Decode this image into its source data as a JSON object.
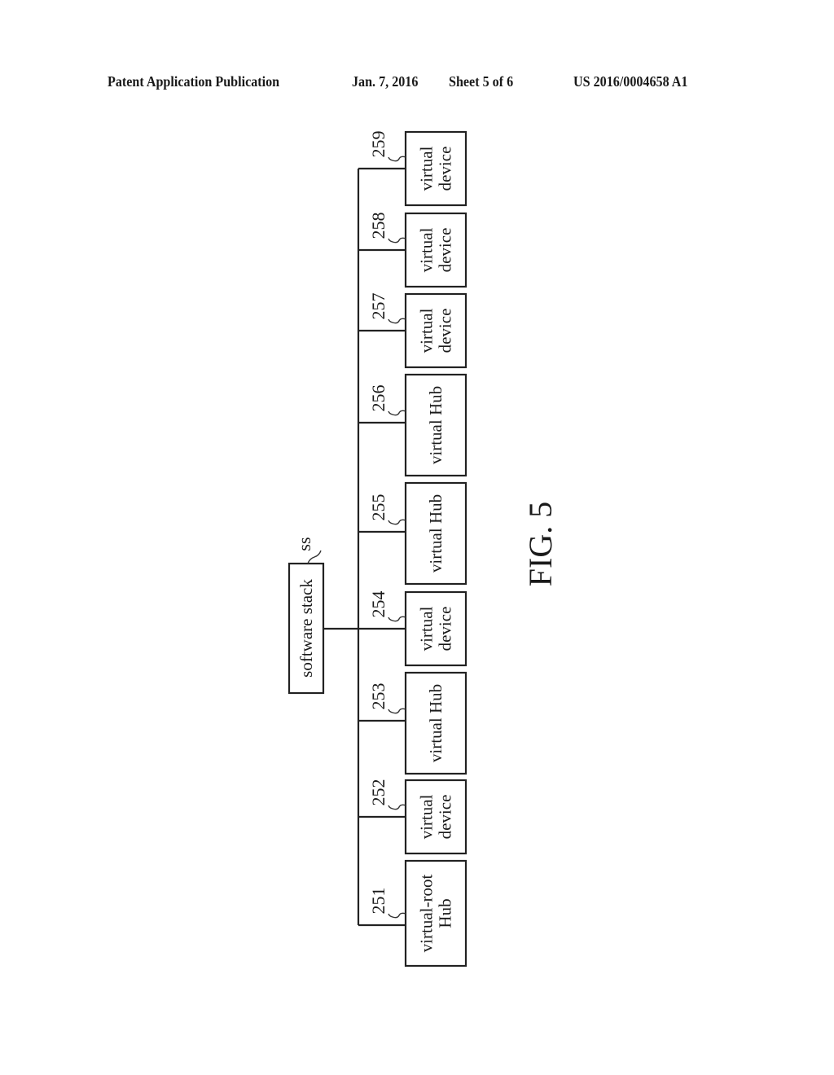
{
  "header": {
    "publication": "Patent Application Publication",
    "date": "Jan. 7, 2016",
    "sheet": "Sheet 5 of 6",
    "number": "US 2016/0004658 A1"
  },
  "figure": {
    "caption": "FIG. 5",
    "root": {
      "label": "software stack",
      "ref": "SS"
    },
    "nodes": [
      {
        "ref": "251",
        "lines": [
          "virtual-root",
          "Hub"
        ]
      },
      {
        "ref": "252",
        "lines": [
          "virtual",
          "device"
        ]
      },
      {
        "ref": "253",
        "lines": [
          "virtual Hub"
        ]
      },
      {
        "ref": "254",
        "lines": [
          "virtual",
          "device"
        ]
      },
      {
        "ref": "255",
        "lines": [
          "virtual Hub"
        ]
      },
      {
        "ref": "256",
        "lines": [
          "virtual Hub"
        ]
      },
      {
        "ref": "257",
        "lines": [
          "virtual",
          "device"
        ]
      },
      {
        "ref": "258",
        "lines": [
          "virtual",
          "device"
        ]
      },
      {
        "ref": "259",
        "lines": [
          "virtual",
          "device"
        ]
      }
    ]
  }
}
